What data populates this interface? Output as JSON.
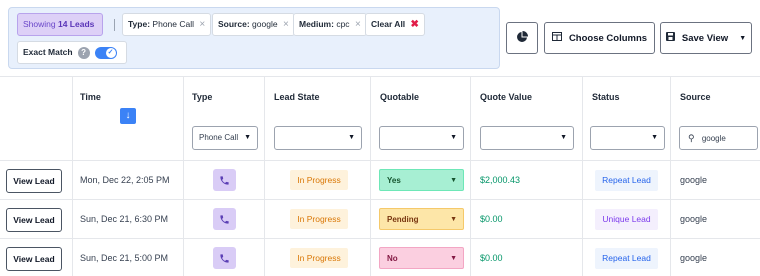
{
  "filters": {
    "showing_prefix": "Showing",
    "showing_count": "14 Leads",
    "chips": [
      {
        "key": "Type:",
        "value": "Phone Call"
      },
      {
        "key": "Source:",
        "value": "google"
      },
      {
        "key": "Medium:",
        "value": "cpc"
      }
    ],
    "clear_all": "Clear All",
    "remove_icon": "×",
    "clear_icon": "✖",
    "exact_match_label": "Exact Match",
    "help_icon": "?",
    "exact_match_on": true,
    "toggle_check": "✓"
  },
  "toolbar": {
    "chart_icon": "pie-chart-icon",
    "choose_columns": "Choose Columns",
    "save_view": "Save View",
    "caret": "▼"
  },
  "table": {
    "headers": [
      "Time",
      "Type",
      "Lead State",
      "Quotable",
      "Quote Value",
      "Status",
      "Source"
    ],
    "sort_arrow": "↓",
    "filter_type_value": "Phone Call",
    "filter_source_value": "google",
    "search_icon": "⚲",
    "dropdown_arrow": "▼",
    "view_label": "View Lead",
    "rows": [
      {
        "time": "Mon, Dec 22, 2:05 PM",
        "state": "In Progress",
        "quotable": "Yes",
        "quote_value": "$2,000.43",
        "status": "Repeat Lead",
        "source": "google"
      },
      {
        "time": "Sun, Dec 21, 6:30 PM",
        "state": "In Progress",
        "quotable": "Pending",
        "quote_value": "$0.00",
        "status": "Unique Lead",
        "source": "google"
      },
      {
        "time": "Sun, Dec 21, 5:00 PM",
        "state": "In Progress",
        "quotable": "No",
        "quote_value": "$0.00",
        "status": "Repeat Lead",
        "source": "google"
      }
    ]
  },
  "colors": {
    "accent": "#3b82f6",
    "purple": "#6a46c9",
    "money_green": "#059669",
    "in_progress": "#d97706"
  }
}
